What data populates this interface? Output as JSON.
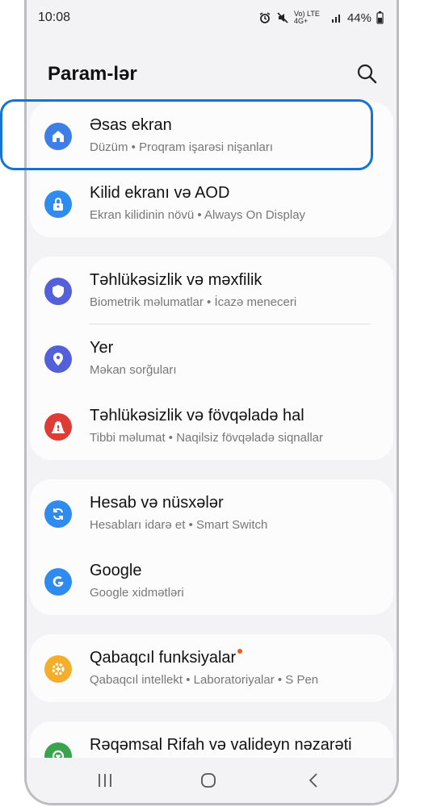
{
  "status_bar": {
    "time": "10:08",
    "network": "Vo) LTE 4G+",
    "battery": "44%"
  },
  "header": {
    "title": "Param-lər"
  },
  "groups": [
    {
      "items": [
        {
          "title": "Əsas ekran",
          "subtitle": "Düzüm  •  Proqram işarəsi nişanları",
          "icon": "home-icon",
          "color": "#3e7ee8"
        },
        {
          "title": "Kilid ekranı və AOD",
          "subtitle": "Ekran kilidinin növü  •  Always On Display",
          "icon": "lock-icon",
          "color": "#2f8cee"
        }
      ]
    },
    {
      "items": [
        {
          "title": "Təhlükəsizlik və məxfilik",
          "subtitle": "Biometrik məlumatlar  •  İcazə meneceri",
          "icon": "shield-icon",
          "color": "#5360da"
        },
        {
          "title": "Yer",
          "subtitle": "Məkan sorğuları",
          "icon": "location-pin-icon",
          "color": "#5360da"
        },
        {
          "title": "Təhlükəsizlik və fövqəladə hal",
          "subtitle": "Tibbi məlumat  •  Naqilsiz fövqəladə siqnallar",
          "icon": "emergency-icon",
          "color": "#df3b37"
        }
      ]
    },
    {
      "items": [
        {
          "title": "Hesab və nüsxələr",
          "subtitle": "Hesabları idarə et  •  Smart Switch",
          "icon": "sync-icon",
          "color": "#2f8cee"
        },
        {
          "title": "Google",
          "subtitle": "Google xidmətləri",
          "icon": "google-icon",
          "color": "#2f8cee"
        }
      ]
    },
    {
      "items": [
        {
          "title": "Qabaqcıl funksiyalar",
          "subtitle": "Qabaqcıl intellekt  •  Laboratoriyalar  •  S Pen",
          "icon": "gear-plus-icon",
          "color": "#f5ad2c"
        }
      ]
    },
    {
      "items": [
        {
          "title": "Rəqəmsal Rifah və valideyn nəzarəti",
          "subtitle": "",
          "icon": "wellbeing-icon",
          "color": "#3aa34d"
        }
      ]
    }
  ]
}
